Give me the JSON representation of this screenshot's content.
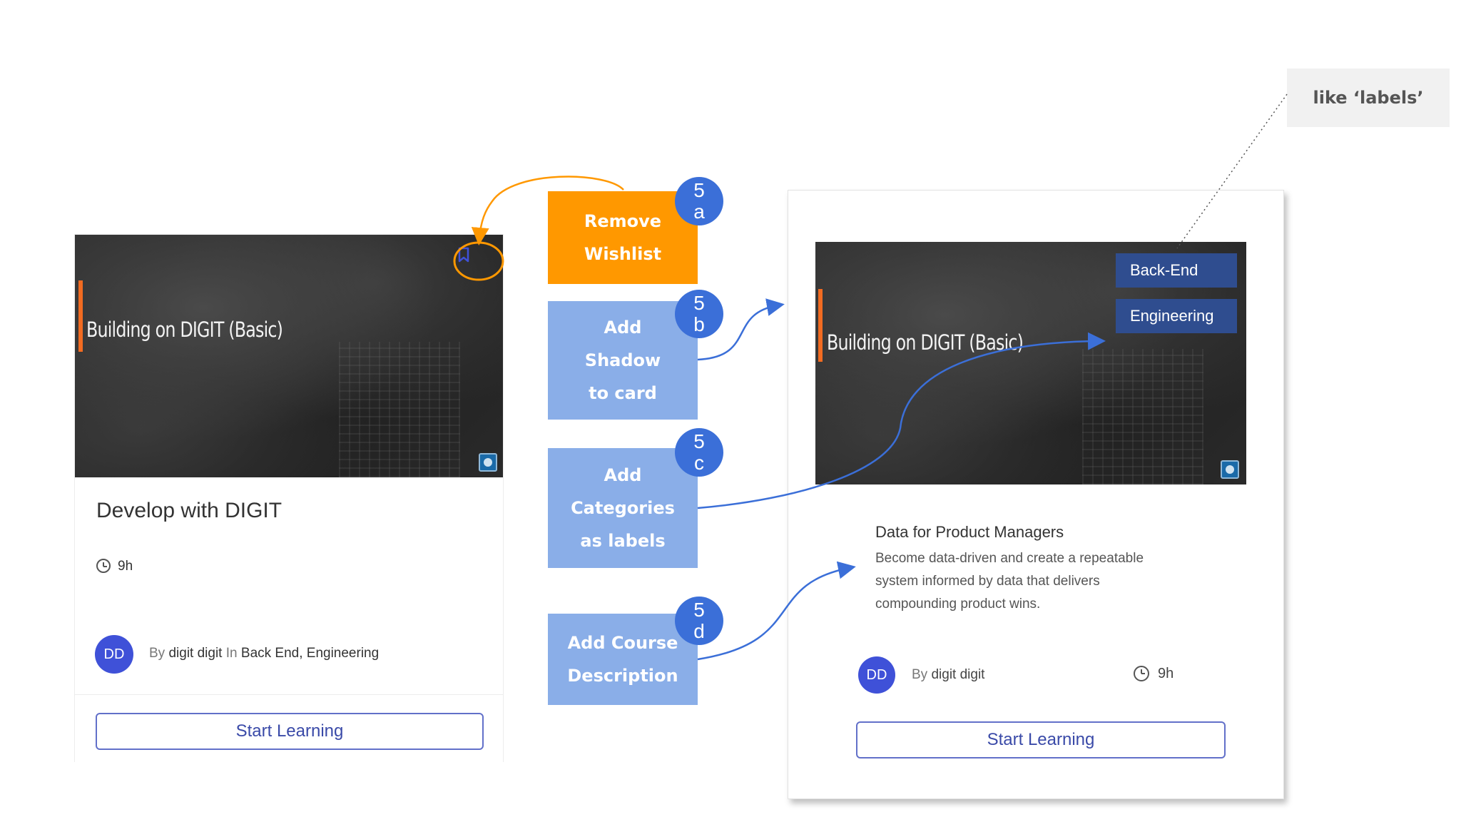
{
  "annotations": {
    "remove_wishlist": {
      "step_number": "5",
      "step_letter": "a",
      "line1": "Remove",
      "line2": "Wishlist"
    },
    "add_shadow": {
      "step_number": "5",
      "step_letter": "b",
      "line1": "Add",
      "line2": "Shadow",
      "line3": "to card"
    },
    "add_categories": {
      "step_number": "5",
      "step_letter": "c",
      "line1": "Add",
      "line2": "Categories",
      "line3": "as labels"
    },
    "add_description": {
      "step_number": "5",
      "step_letter": "d",
      "line1": "Add Course",
      "line2": "Description"
    },
    "callout": "like ‘labels’"
  },
  "old_card": {
    "thumbnail_title": "Building on DIGIT (Basic)",
    "course_title": "Develop with DIGIT",
    "duration": "9h",
    "avatar_initials": "DD",
    "by_prefix": "By",
    "author": "digit digit",
    "in_prefix": "In",
    "categories": "Back End, Engineering",
    "button_label": "Start Learning"
  },
  "new_card": {
    "thumbnail_title": "Building on DIGIT (Basic)",
    "labels": [
      "Back-End",
      "Engineering"
    ],
    "course_title": "Data for Product Managers",
    "description_lines": [
      "Become data-driven and create a repeatable",
      "system informed by data that delivers",
      "compounding product wins."
    ],
    "avatar_initials": "DD",
    "by_prefix": "By",
    "author": "digit digit",
    "duration": "9h",
    "button_label": "Start Learning"
  },
  "colors": {
    "orange": "#ff9800",
    "note_blue": "#8aaee8",
    "badge_blue": "#3b6fd8",
    "label_navy": "#2f4d8f",
    "button_border": "#6270c9"
  }
}
